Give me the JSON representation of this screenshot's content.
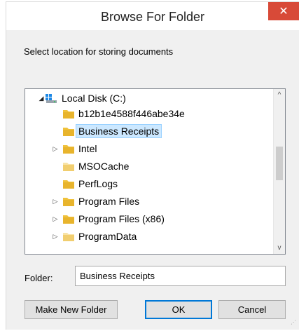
{
  "window": {
    "title": "Browse For Folder",
    "close_icon": "close-icon"
  },
  "prompt": "Select location for storing documents",
  "tree": {
    "root": {
      "label": "Local Disk (C:)",
      "expanded": true,
      "icon": "drive-icon"
    },
    "items": [
      {
        "label": "b12b1e4588f446abe34e",
        "has_children": false,
        "selected": false
      },
      {
        "label": "Business Receipts",
        "has_children": false,
        "selected": true
      },
      {
        "label": "Intel",
        "has_children": true,
        "selected": false
      },
      {
        "label": "MSOCache",
        "has_children": false,
        "selected": false,
        "faded": true
      },
      {
        "label": "PerfLogs",
        "has_children": false,
        "selected": false
      },
      {
        "label": "Program Files",
        "has_children": true,
        "selected": false
      },
      {
        "label": "Program Files (x86)",
        "has_children": true,
        "selected": false
      },
      {
        "label": "ProgramData",
        "has_children": true,
        "selected": false,
        "faded": true
      }
    ]
  },
  "folder_field": {
    "label": "Folder:",
    "value": "Business Receipts"
  },
  "buttons": {
    "make_new_folder": "Make New Folder",
    "ok": "OK",
    "cancel": "Cancel"
  },
  "colors": {
    "close_button": "#d84a38",
    "selection": "#cce8ff",
    "folder": "#f0c23c"
  }
}
